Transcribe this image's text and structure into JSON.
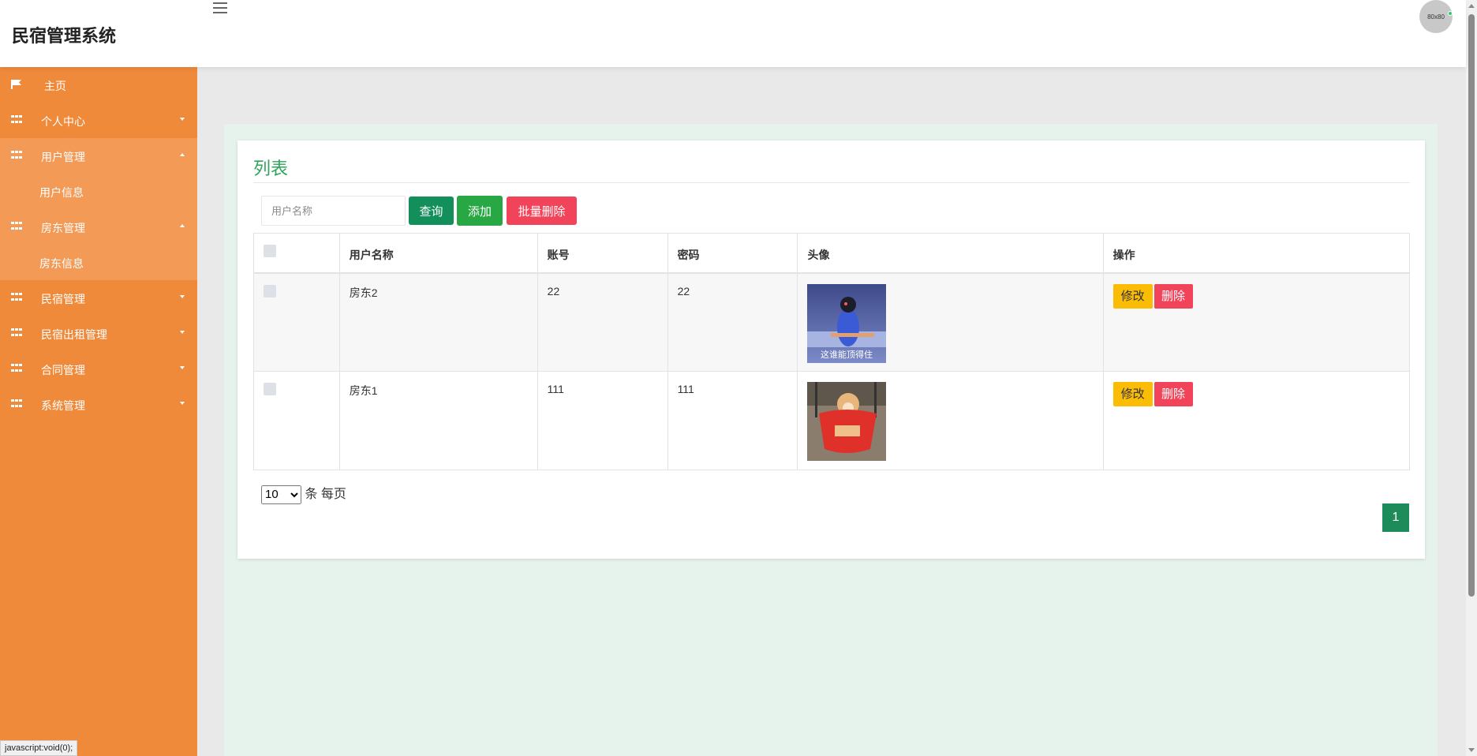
{
  "header": {
    "brand": "民宿管理系统",
    "avatar_text": "80x80"
  },
  "sidebar": {
    "home": "主页",
    "items": [
      {
        "label": "个人中心",
        "expanded": false,
        "sub": []
      },
      {
        "label": "用户管理",
        "expanded": true,
        "sub": [
          "用户信息"
        ]
      },
      {
        "label": "房东管理",
        "expanded": true,
        "sub": [
          "房东信息"
        ]
      },
      {
        "label": "民宿管理",
        "expanded": false,
        "sub": []
      },
      {
        "label": "民宿出租管理",
        "expanded": false,
        "sub": []
      },
      {
        "label": "合同管理",
        "expanded": false,
        "sub": []
      },
      {
        "label": "系统管理",
        "expanded": false,
        "sub": []
      }
    ]
  },
  "panel": {
    "title": "列表",
    "search_placeholder": "用户名称",
    "btn_query": "查询",
    "btn_add": "添加",
    "btn_batch_delete": "批量删除"
  },
  "table": {
    "columns": [
      "用户名称",
      "账号",
      "密码",
      "头像",
      "操作"
    ],
    "rows": [
      {
        "name": "房东2",
        "account": "22",
        "password": "22",
        "avatar_caption": "这谁能顶得住",
        "edit": "修改",
        "delete": "删除"
      },
      {
        "name": "房东1",
        "account": "111",
        "password": "111",
        "avatar_caption": "",
        "edit": "修改",
        "delete": "删除"
      }
    ]
  },
  "pagination": {
    "page_size": "10",
    "page_size_options": [
      "10"
    ],
    "per_page_label": "条 每页",
    "current_page": "1"
  },
  "status_bar": "javascript:void(0);",
  "colors": {
    "sidebar": "#ef8a3b",
    "title_green": "#2fa45a",
    "query": "#138f5b",
    "add": "#28a745",
    "delete": "#f14359",
    "edit": "#fbbc05"
  }
}
